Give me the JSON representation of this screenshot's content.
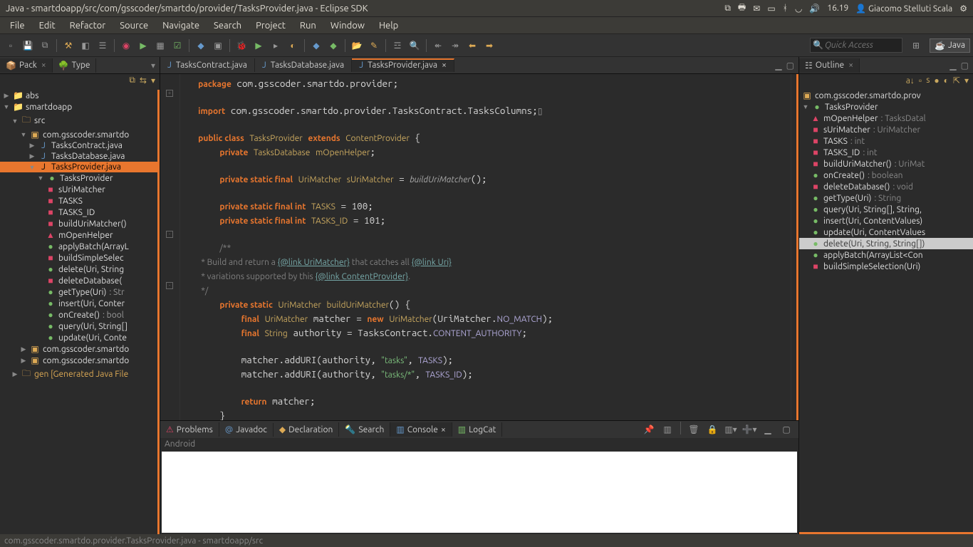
{
  "topbar": {
    "title": "Java - smartdoapp/src/com/gsscoder/smartdo/provider/TasksProvider.java - Eclipse SDK",
    "time": "16.19",
    "user": "Giacomo Stelluti Scala"
  },
  "menu": [
    "File",
    "Edit",
    "Refactor",
    "Source",
    "Navigate",
    "Search",
    "Project",
    "Run",
    "Window",
    "Help"
  ],
  "quick_placeholder": "Quick Access",
  "perspective": "Java",
  "left_tabs": {
    "pack": "Pack",
    "type": "Type"
  },
  "tree": {
    "abs": "abs",
    "app": "smartdoapp",
    "src": "src",
    "pkg": "com.gsscoder.smartdo",
    "f1": "TasksContract.java",
    "f2": "TasksDatabase.java",
    "f3": "TasksProvider.java",
    "cls": "TasksProvider",
    "m_surimatcher": "sUriMatcher",
    "m_tasks": "TASKS",
    "m_tasksid": "TASKS_ID",
    "m_builduri": "buildUriMatcher()",
    "m_mopen": "mOpenHelper",
    "m_apply": "applyBatch(ArrayL",
    "m_buildsimple": "buildSimpleSelec",
    "m_delete": "delete(Uri, String",
    "m_deletedb": "deleteDatabase(",
    "m_gettype": "getType(Uri)",
    "m_gettype_t": ": Str",
    "m_insert": "insert(Uri, Conter",
    "m_oncreate": "onCreate()",
    "m_oncreate_t": ": bool",
    "m_query": "query(Uri, String[]",
    "m_update": "update(Uri, Conte",
    "pkg2": "com.gsscoder.smartdo",
    "pkg3": "com.gsscoder.smartdo",
    "gen": "gen [Generated Java File"
  },
  "editor_tabs": {
    "contract": "TasksContract.java",
    "db": "TasksDatabase.java",
    "prov": "TasksProvider.java"
  },
  "outline_tab": "Outline",
  "outline": {
    "pkg": "com.gsscoder.smartdo.prov",
    "cls": "TasksProvider",
    "mopen": "mOpenHelper",
    "mopen_t": ": TasksDatal",
    "suri": "sUriMatcher",
    "suri_t": ": UriMatcher",
    "tasks": "TASKS",
    "tasks_t": ": int",
    "tasksid": "TASKS_ID",
    "tasksid_t": ": int",
    "build": "buildUriMatcher()",
    "build_t": ": UriMat",
    "oncreate": "onCreate()",
    "oncreate_t": ": boolean",
    "deletedb": "deleteDatabase()",
    "deletedb_t": ": void",
    "gettype": "getType(Uri)",
    "gettype_t": ": String",
    "query": "query(Uri, String[], String,",
    "insert": "insert(Uri, ContentValues)",
    "update": "update(Uri, ContentValues",
    "delete": "delete(Uri, String, String[])",
    "apply": "applyBatch(ArrayList<Con",
    "buildsimple": "buildSimpleSelection(Uri)"
  },
  "bottom_tabs": {
    "problems": "Problems",
    "javadoc": "Javadoc",
    "decl": "Declaration",
    "search": "Search",
    "console": "Console",
    "logcat": "LogCat"
  },
  "console_head": "Android",
  "status": "com.gsscoder.smartdo.provider.TasksProvider.java - smartdoapp/src"
}
